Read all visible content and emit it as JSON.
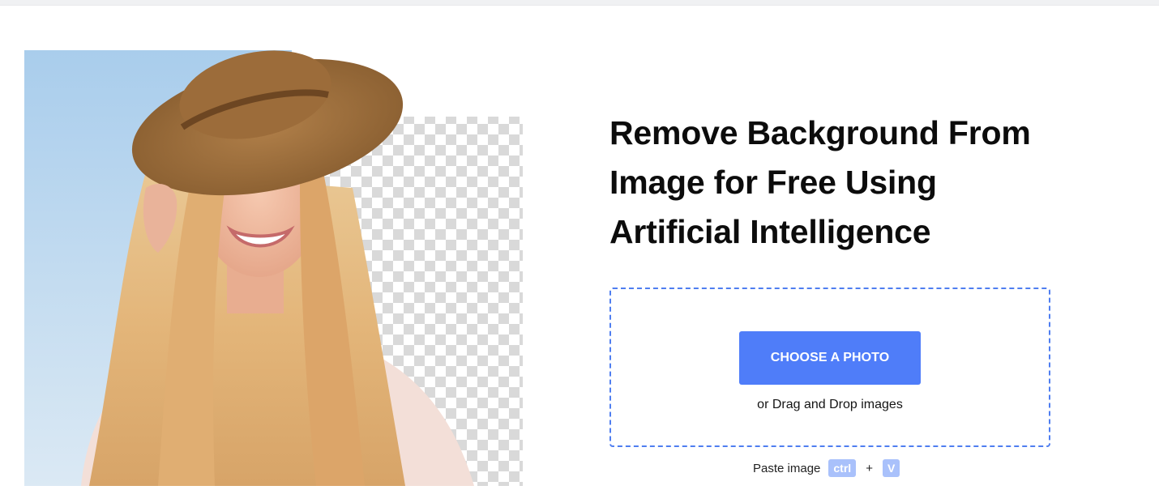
{
  "hero": {
    "image_description_icon": "woman-with-hat-portrait",
    "sky_color": "#b9d6ee",
    "checker_light": "#ffffff",
    "checker_dark": "#d7d7d7"
  },
  "headline": {
    "line1": "Remove Background From",
    "line2": "Image for Free Using",
    "line3": "Artificial Intelligence"
  },
  "upload": {
    "button_label": "CHOOSE A PHOTO",
    "drop_hint": "or Drag and Drop images",
    "accent_color": "#4f7df9"
  },
  "paste": {
    "label": "Paste image",
    "key1": "ctrl",
    "plus": "+",
    "key2": "V"
  }
}
